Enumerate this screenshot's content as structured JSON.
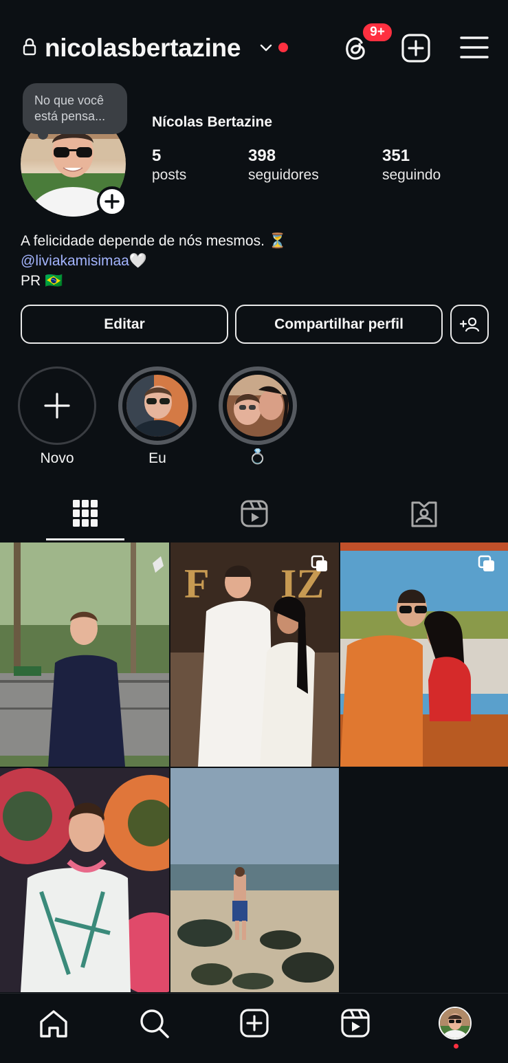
{
  "header": {
    "username": "nicolasbertazine",
    "notif_badge": "9+",
    "icons": [
      "lock-icon",
      "chevron-down-icon",
      "threads-icon",
      "new-post-icon",
      "menu-icon"
    ]
  },
  "profile": {
    "note_text": "No que você está pensa...",
    "display_name": "Nícolas Bertazine",
    "stats": [
      {
        "value": "5",
        "label": "posts"
      },
      {
        "value": "398",
        "label": "seguidores"
      },
      {
        "value": "351",
        "label": "seguindo"
      }
    ],
    "bio_line1": "A felicidade depende de nós mesmos. ⏳",
    "bio_mention": "@liviakamisimaa",
    "bio_mention_suffix": "🤍",
    "bio_line3": "PR 🇧🇷"
  },
  "buttons": {
    "edit": "Editar",
    "share": "Compartilhar perfil"
  },
  "highlights": [
    {
      "label": "Novo"
    },
    {
      "label": "Eu"
    },
    {
      "label": "💍"
    }
  ],
  "tabs": [
    "grid-icon",
    "reels-icon",
    "tagged-icon"
  ],
  "bottom_nav": [
    "home-icon",
    "search-icon",
    "create-icon",
    "reels-icon",
    "profile-avatar"
  ],
  "colors": {
    "background": "#0c1014",
    "accent_red": "#ff3040",
    "mention": "#a4b5ff"
  }
}
